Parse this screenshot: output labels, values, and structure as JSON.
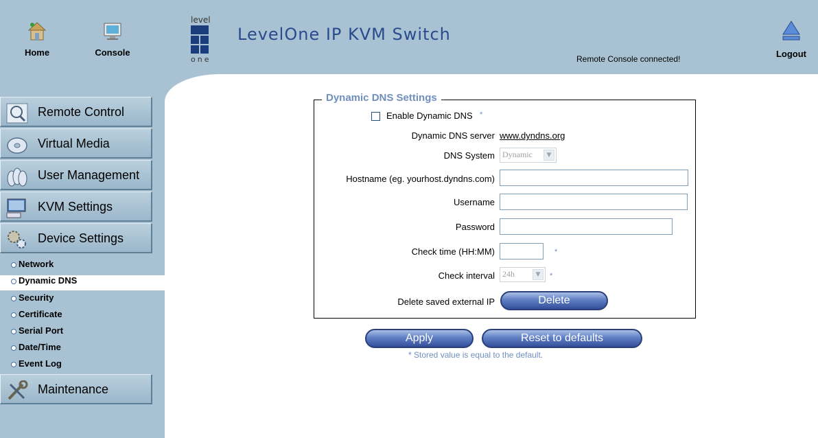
{
  "header": {
    "home_label": "Home",
    "console_label": "Console",
    "logo_text_top": "level",
    "logo_text_bottom": "one",
    "app_title": "LevelOne IP KVM Switch",
    "status": "Remote Console connected!",
    "logout_label": "Logout"
  },
  "sidebar": {
    "menus": [
      {
        "label": "Remote Control",
        "icon": "magnifier-icon"
      },
      {
        "label": "Virtual Media",
        "icon": "disc-icon"
      },
      {
        "label": "User Management",
        "icon": "users-icon"
      },
      {
        "label": "KVM Settings",
        "icon": "monitor-keyboard-icon"
      },
      {
        "label": "Device Settings",
        "icon": "gears-icon"
      }
    ],
    "submenu": [
      {
        "label": "Network",
        "active": false
      },
      {
        "label": "Dynamic DNS",
        "active": true
      },
      {
        "label": "Security",
        "active": false
      },
      {
        "label": "Certificate",
        "active": false
      },
      {
        "label": "Serial Port",
        "active": false
      },
      {
        "label": "Date/Time",
        "active": false
      },
      {
        "label": "Event Log",
        "active": false
      }
    ],
    "maintenance_label": "Maintenance"
  },
  "form": {
    "legend": "Dynamic DNS Settings",
    "enable_label": "Enable Dynamic DNS",
    "enable_checked": false,
    "server_label": "Dynamic DNS server",
    "server_value": "www.dyndns.org",
    "system_label": "DNS System",
    "system_value": "Dynamic",
    "hostname_label": "Hostname (eg. yourhost.dyndns.com)",
    "hostname_value": "",
    "username_label": "Username",
    "username_value": "",
    "password_label": "Password",
    "password_value": "",
    "checktime_label": "Check time (HH:MM)",
    "checktime_value": "",
    "interval_label": "Check interval",
    "interval_value": "24h",
    "delete_label": "Delete saved external IP",
    "delete_button": "Delete",
    "star": "*"
  },
  "actions": {
    "apply": "Apply",
    "reset": "Reset to defaults",
    "note": "* Stored value is equal to the default."
  },
  "colors": {
    "frame_bg": "#a9c2d3",
    "accent": "#6f8fbf",
    "title": "#2a4a8e"
  }
}
